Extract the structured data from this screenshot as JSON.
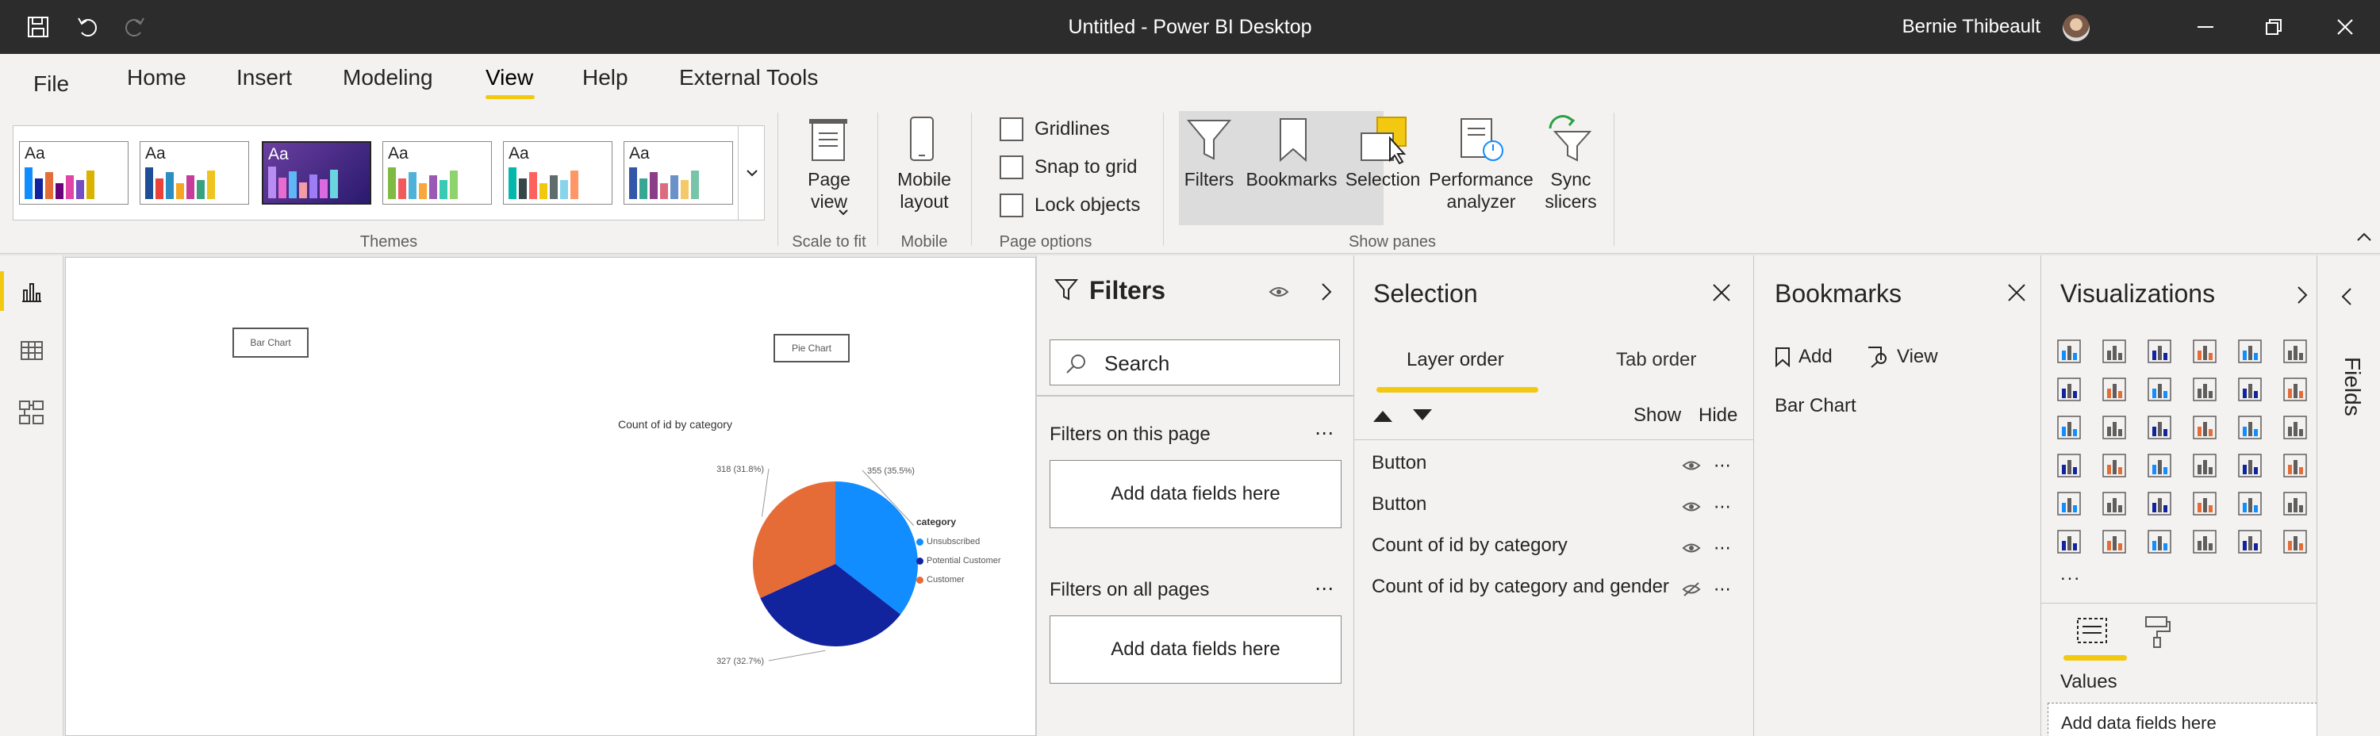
{
  "app": {
    "title": "Untitled - Power BI Desktop",
    "user": "Bernie Thibeault"
  },
  "menu": {
    "file": "File",
    "tabs": [
      "Home",
      "Insert",
      "Modeling",
      "View",
      "Help",
      "External Tools"
    ],
    "active": "View"
  },
  "ribbon": {
    "themes": {
      "label": "Themes",
      "thumb_text": "Aa",
      "selected_index": 2
    },
    "scale": {
      "button": "Page view",
      "group": "Scale to fit"
    },
    "mobile": {
      "button": "Mobile layout",
      "group": "Mobile"
    },
    "page_options": {
      "items": [
        "Gridlines",
        "Snap to grid",
        "Lock objects"
      ],
      "group": "Page options"
    },
    "show_panes": {
      "items": [
        "Filters",
        "Bookmarks",
        "Selection",
        "Performance analyzer",
        "Sync slicers"
      ],
      "group": "Show panes"
    }
  },
  "canvas": {
    "button1": "Bar Chart",
    "button2": "Pie Chart",
    "chart_title": "Count of id by category",
    "legend_title": "category"
  },
  "chart_data": {
    "type": "pie",
    "title": "Count of id by category",
    "legend_title": "category",
    "slices": [
      {
        "name": "Unsubscribed",
        "value": 355,
        "label": "355 (35.5%)",
        "color": "#118dff"
      },
      {
        "name": "Potential Customer",
        "value": 327,
        "label": "327 (32.7%)",
        "color": "#12239e"
      },
      {
        "name": "Customer",
        "value": 318,
        "label": "318 (31.8%)",
        "color": "#e66c37"
      }
    ]
  },
  "filters": {
    "title": "Filters",
    "search_placeholder": "Search",
    "on_page": "Filters on this page",
    "on_all": "Filters on all pages",
    "add_fields": "Add data fields here"
  },
  "selection": {
    "title": "Selection",
    "tabs": [
      "Layer order",
      "Tab order"
    ],
    "show": "Show",
    "hide": "Hide",
    "rows": [
      "Button",
      "Button",
      "Count of id by category",
      "Count of id by category and gender"
    ]
  },
  "bookmarks": {
    "title": "Bookmarks",
    "add": "Add",
    "view": "View",
    "items": [
      "Bar Chart"
    ]
  },
  "visualizations": {
    "title": "Visualizations",
    "values_label": "Values",
    "add_fields": "Add data fields here",
    "more": "...",
    "fields_tab": "Fields"
  },
  "colors": {
    "accent": "#f2c811",
    "titlebar": "#2c2c2c",
    "ribbon": "#f3f2f1"
  }
}
